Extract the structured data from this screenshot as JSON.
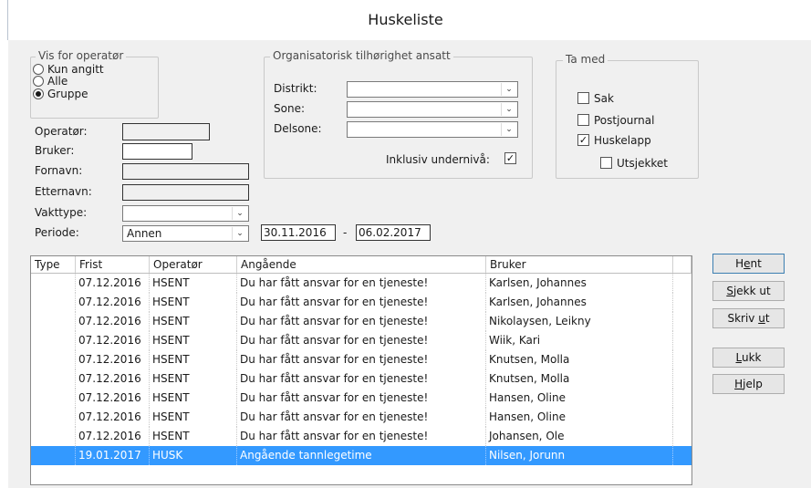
{
  "window": {
    "title": "Huskeliste"
  },
  "vis_for": {
    "legend": "Vis for operatør",
    "options": [
      {
        "label": "Kun angitt",
        "selected": false
      },
      {
        "label": "Alle",
        "selected": false
      },
      {
        "label": "Gruppe",
        "selected": true
      }
    ]
  },
  "org": {
    "legend": "Organisatorisk tilhørighet ansatt",
    "distrikt_label": "Distrikt:",
    "sone_label": "Sone:",
    "delsone_label": "Delsone:",
    "distrikt_value": "",
    "sone_value": "",
    "delsone_value": "",
    "inklusiv_label": "Inklusiv undernivå:",
    "inklusiv_checked": true
  },
  "ta_med": {
    "legend": "Ta med",
    "items": [
      {
        "label": "Sak",
        "checked": false
      },
      {
        "label": "Postjournal",
        "checked": false
      },
      {
        "label": "Huskelapp",
        "checked": true
      },
      {
        "label": "Utsjekket",
        "checked": false
      }
    ]
  },
  "fields": {
    "operator_label": "Operatør:",
    "bruker_label": "Bruker:",
    "fornavn_label": "Fornavn:",
    "etternavn_label": "Etternavn:",
    "vakttype_label": "Vakttype:",
    "periode_label": "Periode:",
    "operator_value": "",
    "bruker_value": "",
    "fornavn_value": "",
    "etternavn_value": "",
    "vakttype_value": "",
    "periode_value": "Annen",
    "date_from": "30.11.2016",
    "date_sep": "-",
    "date_to": "06.02.2017"
  },
  "table": {
    "columns": [
      "Type",
      "Frist",
      "Operatør",
      "Angående",
      "Bruker"
    ],
    "rows": [
      {
        "type": "",
        "frist": "07.12.2016",
        "operator": "HSENT",
        "angaende": "Du har fått ansvar for en tjeneste!",
        "bruker": "Karlsen, Johannes"
      },
      {
        "type": "",
        "frist": "07.12.2016",
        "operator": "HSENT",
        "angaende": "Du har fått ansvar for en tjeneste!",
        "bruker": "Karlsen, Johannes"
      },
      {
        "type": "",
        "frist": "07.12.2016",
        "operator": "HSENT",
        "angaende": "Du har fått ansvar for en tjeneste!",
        "bruker": "Nikolaysen, Leikny"
      },
      {
        "type": "",
        "frist": "07.12.2016",
        "operator": "HSENT",
        "angaende": "Du har fått ansvar for en tjeneste!",
        "bruker": "Wiik, Kari"
      },
      {
        "type": "",
        "frist": "07.12.2016",
        "operator": "HSENT",
        "angaende": "Du har fått ansvar for en tjeneste!",
        "bruker": "Knutsen, Molla"
      },
      {
        "type": "",
        "frist": "07.12.2016",
        "operator": "HSENT",
        "angaende": "Du har fått ansvar for en tjeneste!",
        "bruker": "Knutsen, Molla"
      },
      {
        "type": "",
        "frist": "07.12.2016",
        "operator": "HSENT",
        "angaende": "Du har fått ansvar for en tjeneste!",
        "bruker": "Hansen, Oline"
      },
      {
        "type": "",
        "frist": "07.12.2016",
        "operator": "HSENT",
        "angaende": "Du har fått ansvar for en tjeneste!",
        "bruker": "Hansen, Oline"
      },
      {
        "type": "",
        "frist": "07.12.2016",
        "operator": "HSENT",
        "angaende": "Du har fått ansvar for en tjeneste!",
        "bruker": "Johansen, Ole"
      },
      {
        "type": "",
        "frist": "19.01.2017",
        "operator": "HUSK",
        "angaende": "Angående tannlegetime",
        "bruker": "Nilsen, Jorunn",
        "selected": true
      }
    ]
  },
  "buttons": {
    "hent": {
      "pre": "H",
      "key": "e",
      "post": "nt"
    },
    "sjekk_ut": {
      "pre": "",
      "key": "S",
      "post": "jekk ut"
    },
    "skriv_ut": {
      "pre": "Skriv ",
      "key": "u",
      "post": "t"
    },
    "lukk": {
      "pre": "",
      "key": "L",
      "post": "ukk"
    },
    "hjelp": {
      "pre": "",
      "key": "H",
      "post": "jelp"
    }
  },
  "colors": {
    "selection": "#3399ff",
    "window_bg": "#f0f0f0"
  }
}
